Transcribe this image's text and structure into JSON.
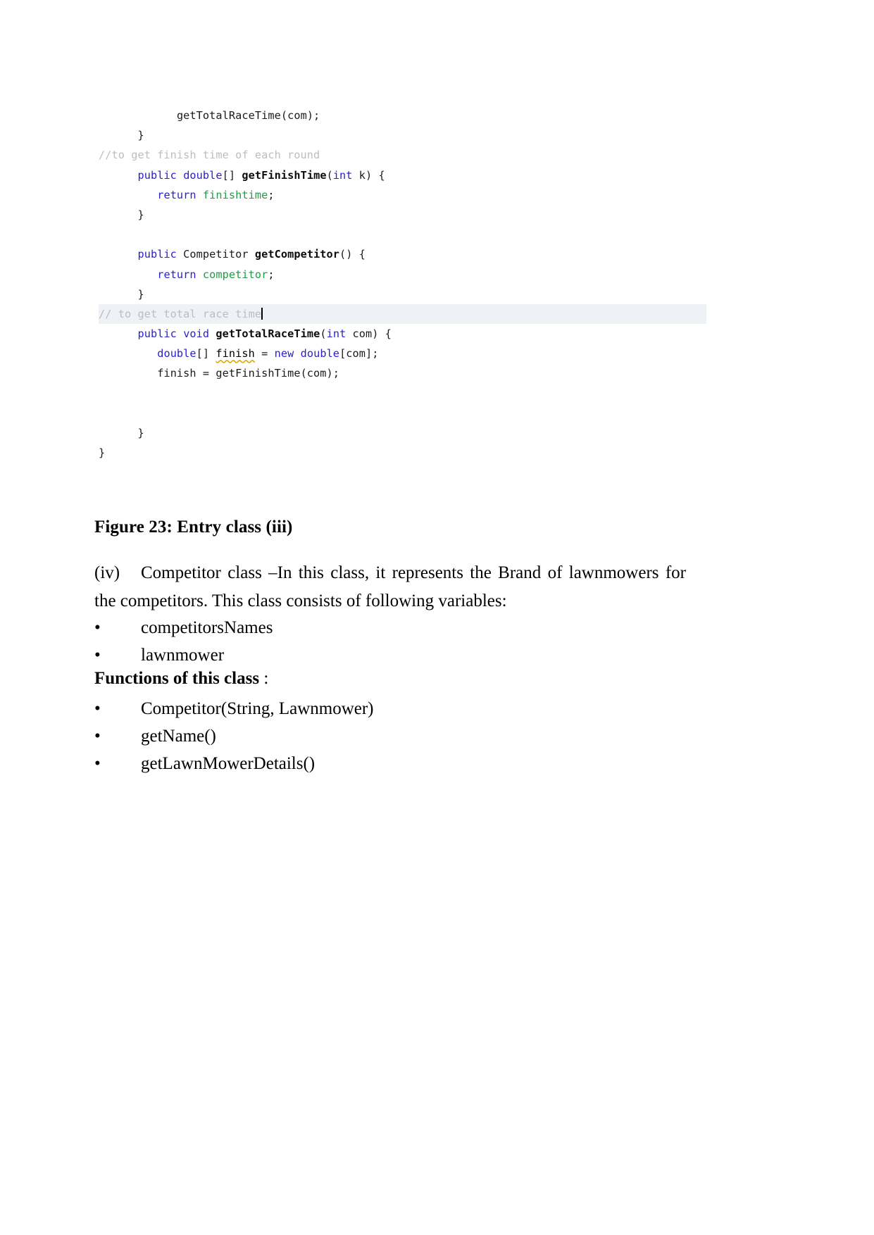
{
  "document": {
    "figure_caption": "Figure 23: Entry class (iii)",
    "paragraph": {
      "marker": "(iv)",
      "text": "Competitor class –In this class, it represents the Brand of lawnmowers for the competitors. This class consists of following variables:"
    },
    "variables_list": [
      "competitorsNames",
      "lawnmower"
    ],
    "functions_heading": {
      "bold_text": "Functions of this class",
      "suffix": " :"
    },
    "functions_list": [
      "Competitor(String, Lawnmower)",
      "getName()",
      "getLawnMowerDetails()"
    ],
    "bullet_glyph": "•"
  },
  "code_figure": {
    "highlight_color": "#eef1f6",
    "colors": {
      "keyword": "#2b20c9",
      "method_name": "#0b0b0b",
      "field": "#1f9b45",
      "comment": "#b9bdc4",
      "plain": "#1a1a1a",
      "squiggle_underline": "#d9a400",
      "caret": "#000000"
    },
    "lines": [
      {
        "id": "l1",
        "indent": 12,
        "tokens": [
          {
            "t": "getTotalRaceTime",
            "c": "plain"
          },
          {
            "t": "(com);",
            "c": "plain"
          }
        ]
      },
      {
        "id": "l2",
        "indent": 6,
        "tokens": [
          {
            "t": "}",
            "c": "brace"
          }
        ]
      },
      {
        "id": "l3",
        "indent": 0,
        "tokens": [
          {
            "t": "//to get finish time of each round",
            "c": "comment"
          }
        ]
      },
      {
        "id": "l4",
        "indent": 6,
        "tokens": [
          {
            "t": "public",
            "c": "kw"
          },
          {
            "t": " ",
            "c": "plain"
          },
          {
            "t": "double",
            "c": "kw"
          },
          {
            "t": "[] ",
            "c": "plain"
          },
          {
            "t": "getFinishTime",
            "c": "mname"
          },
          {
            "t": "(",
            "c": "plain"
          },
          {
            "t": "int",
            "c": "kw"
          },
          {
            "t": " k) {",
            "c": "plain"
          }
        ]
      },
      {
        "id": "l5",
        "indent": 9,
        "tokens": [
          {
            "t": "return",
            "c": "kw"
          },
          {
            "t": " ",
            "c": "plain"
          },
          {
            "t": "finishtime",
            "c": "field"
          },
          {
            "t": ";",
            "c": "plain"
          }
        ]
      },
      {
        "id": "l6",
        "indent": 6,
        "tokens": [
          {
            "t": "}",
            "c": "brace"
          }
        ]
      },
      {
        "id": "l7",
        "indent": 0,
        "tokens": []
      },
      {
        "id": "l8",
        "indent": 6,
        "tokens": [
          {
            "t": "public",
            "c": "kw"
          },
          {
            "t": " Competitor ",
            "c": "plain"
          },
          {
            "t": "getCompetitor",
            "c": "mname"
          },
          {
            "t": "() {",
            "c": "plain"
          }
        ]
      },
      {
        "id": "l9",
        "indent": 9,
        "tokens": [
          {
            "t": "return",
            "c": "kw"
          },
          {
            "t": " ",
            "c": "plain"
          },
          {
            "t": "competitor",
            "c": "field"
          },
          {
            "t": ";",
            "c": "plain"
          }
        ]
      },
      {
        "id": "l10",
        "indent": 6,
        "tokens": [
          {
            "t": "}",
            "c": "brace"
          }
        ]
      },
      {
        "id": "l11",
        "indent": 0,
        "highlighted": true,
        "caret": true,
        "tokens": [
          {
            "t": "// to get total race time",
            "c": "comment"
          }
        ]
      },
      {
        "id": "l12",
        "indent": 6,
        "tokens": [
          {
            "t": "public",
            "c": "kw"
          },
          {
            "t": " ",
            "c": "plain"
          },
          {
            "t": "void",
            "c": "kw"
          },
          {
            "t": " ",
            "c": "plain"
          },
          {
            "t": "getTotalRaceTime",
            "c": "mname"
          },
          {
            "t": "(",
            "c": "plain"
          },
          {
            "t": "int",
            "c": "kw"
          },
          {
            "t": " com) {",
            "c": "plain"
          }
        ]
      },
      {
        "id": "l13",
        "indent": 9,
        "tokens": [
          {
            "t": "double",
            "c": "kw"
          },
          {
            "t": "[] ",
            "c": "plain"
          },
          {
            "t": "finish",
            "c": "squiggle"
          },
          {
            "t": " = ",
            "c": "plain"
          },
          {
            "t": "new",
            "c": "kw"
          },
          {
            "t": " ",
            "c": "plain"
          },
          {
            "t": "double",
            "c": "kw"
          },
          {
            "t": "[com];",
            "c": "plain"
          }
        ]
      },
      {
        "id": "l14",
        "indent": 9,
        "tokens": [
          {
            "t": "finish = getFinishTime(com);",
            "c": "plain"
          }
        ]
      },
      {
        "id": "l15",
        "indent": 0,
        "tokens": []
      },
      {
        "id": "l16",
        "indent": 0,
        "tokens": []
      },
      {
        "id": "l17",
        "indent": 6,
        "tokens": [
          {
            "t": "}",
            "c": "brace"
          }
        ]
      },
      {
        "id": "l18",
        "indent": 0,
        "tokens": [
          {
            "t": "}",
            "c": "brace"
          }
        ]
      }
    ]
  }
}
